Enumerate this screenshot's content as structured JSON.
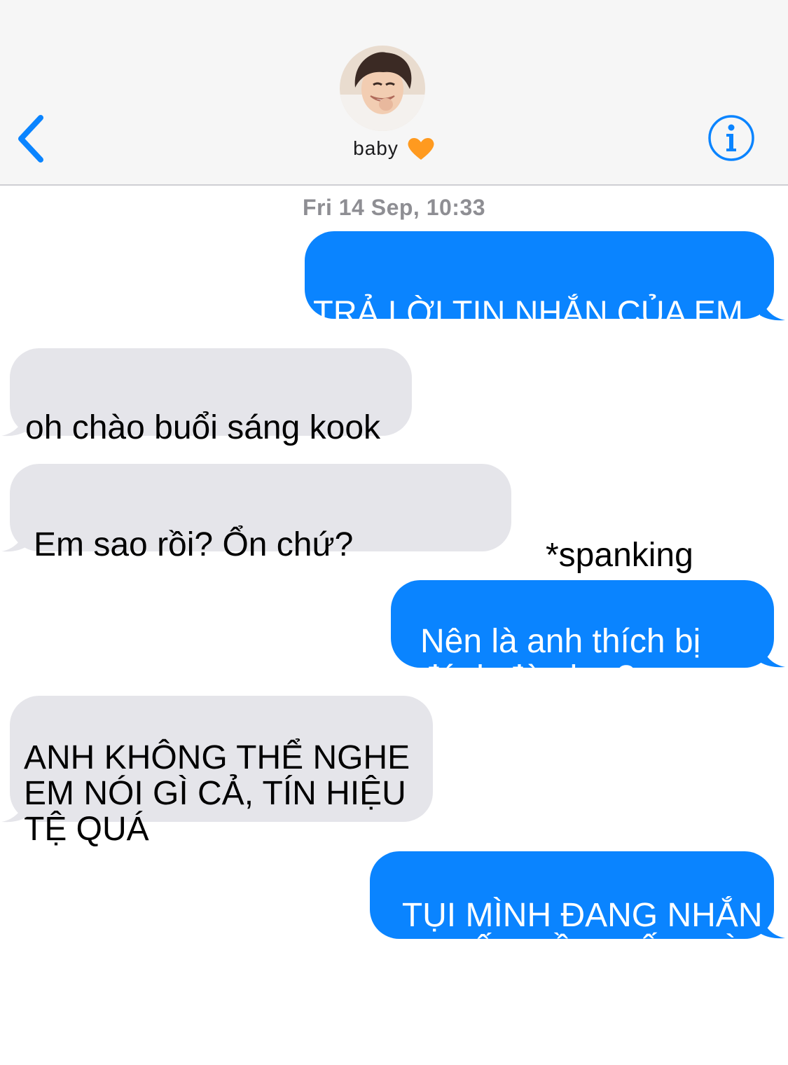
{
  "header": {
    "back_icon": "chevron-left-icon",
    "contact_name": "baby",
    "contact_emoji": "orange-heart-icon",
    "info_icon": "info-icon",
    "accent_color": "#0a84ff"
  },
  "timestamp": "Fri 14 Sep, 10:33",
  "messages": [
    {
      "direction": "sent",
      "text": "TRẢ LỜI TIN NHẮN CỦA EM"
    },
    {
      "direction": "received",
      "text": "oh chào buổi sáng kook"
    },
    {
      "direction": "received",
      "text": "Em sao rồi? Ổn chứ?"
    },
    {
      "direction": "sent",
      "text": "Nên là anh thích bị\nđánh đòn hm?"
    },
    {
      "direction": "received",
      "text": "ANH KHÔNG THỂ NGHE\nEM NÓI GÌ CẢ, TÍN HIỆU\nTỆ QUÁ"
    },
    {
      "direction": "sent",
      "text": "TỤI MÌNH ĐANG NHẮN\nTIN ĐẤY ĐỒ NGỐC NÀY"
    }
  ],
  "annotation": "*spanking",
  "colors": {
    "sent_bubble": "#0a84ff",
    "received_bubble": "#e5e5ea",
    "header_bg": "#f6f6f6"
  }
}
